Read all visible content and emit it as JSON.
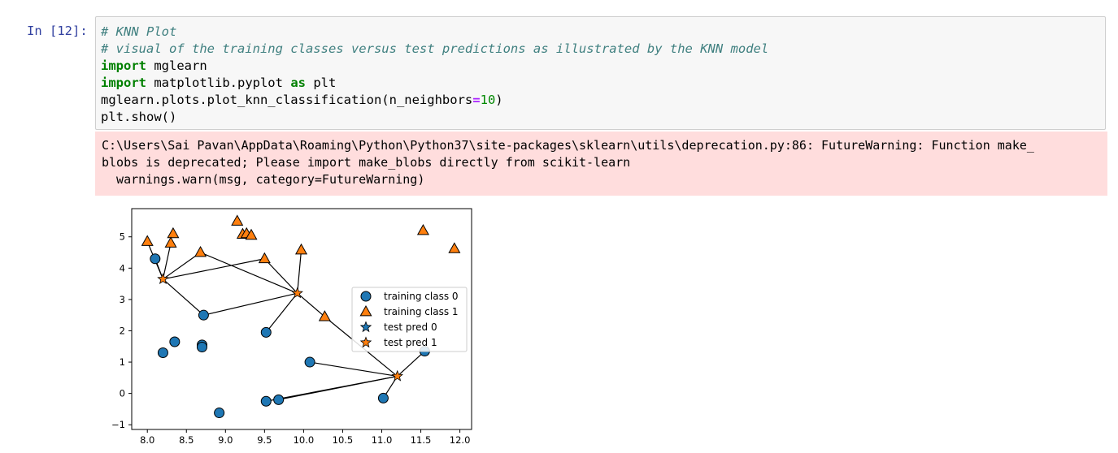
{
  "cell": {
    "prompt": "In [12]:",
    "code": {
      "line1": "# KNN Plot",
      "line2": "# visual of the training classes versus test predictions as illustrated by the KNN model",
      "line3_kw": "import",
      "line3_rest": " mglearn",
      "line4_kw1": "import",
      "line4_mid": " matplotlib.pyplot ",
      "line4_kw2": "as",
      "line4_rest": " plt",
      "line5_a": "mglearn.plots.plot_knn_classification(n_neighbors",
      "line5_op": "=",
      "line5_num": "10",
      "line5_close": ")",
      "line6": "plt.show()"
    },
    "stderr": {
      "line1": "C:\\Users\\Sai Pavan\\AppData\\Roaming\\Python\\Python37\\site-packages\\sklearn\\utils\\deprecation.py:86: FutureWarning: Function make_",
      "line2": "blobs is deprecated; Please import make_blobs directly from scikit-learn",
      "line3": "  warnings.warn(msg, category=FutureWarning)"
    }
  },
  "colors": {
    "class0": "#1f77b4",
    "class1": "#ff7f0e",
    "prompt": "#303f9f",
    "stderr_bg": "#ffdddd"
  },
  "chart_data": {
    "type": "scatter",
    "title": "",
    "xlabel": "",
    "ylabel": "",
    "xlim": [
      7.8,
      12.15
    ],
    "ylim": [
      -1.15,
      5.9
    ],
    "xticks": [
      "8.0",
      "8.5",
      "9.0",
      "9.5",
      "10.0",
      "10.5",
      "11.0",
      "11.5",
      "12.0"
    ],
    "yticks": [
      "−1",
      "0",
      "1",
      "2",
      "3",
      "4",
      "5"
    ],
    "legend_position": "center-right",
    "legend": [
      {
        "label": "training class 0",
        "marker": "circle",
        "color": "#1f77b4"
      },
      {
        "label": "training class 1",
        "marker": "triangle",
        "color": "#ff7f0e"
      },
      {
        "label": "test pred 0",
        "marker": "star",
        "color": "#1f77b4"
      },
      {
        "label": "test pred 1",
        "marker": "star",
        "color": "#ff7f0e"
      }
    ],
    "series": [
      {
        "name": "training class 0",
        "points": [
          [
            8.1,
            4.3
          ],
          [
            8.72,
            2.5
          ],
          [
            8.35,
            1.65
          ],
          [
            8.2,
            1.3
          ],
          [
            8.7,
            1.55
          ],
          [
            8.7,
            1.48
          ],
          [
            9.52,
            1.95
          ],
          [
            10.08,
            1.0
          ],
          [
            11.55,
            1.35
          ],
          [
            11.02,
            -0.15
          ],
          [
            9.68,
            -0.2
          ],
          [
            9.52,
            -0.25
          ],
          [
            8.92,
            -0.62
          ]
        ]
      },
      {
        "name": "training class 1",
        "points": [
          [
            8.0,
            4.85
          ],
          [
            8.33,
            5.1
          ],
          [
            8.3,
            4.8
          ],
          [
            8.68,
            4.5
          ],
          [
            9.15,
            5.5
          ],
          [
            9.22,
            5.08
          ],
          [
            9.27,
            5.1
          ],
          [
            9.33,
            5.05
          ],
          [
            9.5,
            4.3
          ],
          [
            9.97,
            4.58
          ],
          [
            10.27,
            2.45
          ],
          [
            11.53,
            5.2
          ],
          [
            11.93,
            4.62
          ]
        ]
      },
      {
        "name": "test pred 0",
        "points": []
      },
      {
        "name": "test pred 1",
        "points": [
          [
            8.2,
            3.65
          ],
          [
            9.92,
            3.2
          ],
          [
            11.2,
            0.55
          ]
        ]
      }
    ]
  }
}
